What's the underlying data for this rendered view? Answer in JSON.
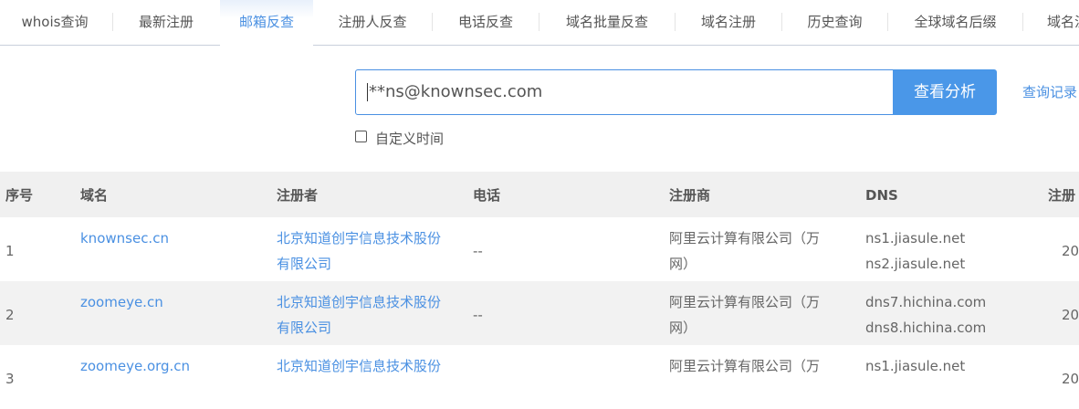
{
  "tabs": [
    "whois查询",
    "最新注册",
    "邮箱反查",
    "注册人反查",
    "电话反查",
    "域名批量反查",
    "域名注册",
    "历史查询",
    "全球域名后缀",
    "域名注"
  ],
  "active_tab": 2,
  "search": {
    "value": "**ns@knownsec.com",
    "button": "查看分析",
    "history_link": "查询记录",
    "custom_time_label": "自定义时间"
  },
  "table": {
    "headers": [
      "序号",
      "域名",
      "注册者",
      "电话",
      "注册商",
      "DNS",
      "注册"
    ],
    "rows": [
      {
        "index": "1",
        "domain": "knownsec.cn",
        "registrant_line1": "北京知道创宇信息技术股份",
        "registrant_line2": "有限公司",
        "phone": "--",
        "registrar_line1": "阿里云计算有限公司（万",
        "registrar_line2": "网）",
        "dns1": "ns1.jiasule.net",
        "dns2": "ns2.jiasule.net",
        "date": "20"
      },
      {
        "index": "2",
        "domain": "zoomeye.cn",
        "registrant_line1": "北京知道创宇信息技术股份",
        "registrant_line2": "有限公司",
        "phone": "--",
        "registrar_line1": "阿里云计算有限公司（万",
        "registrar_line2": "网）",
        "dns1": "dns7.hichina.com",
        "dns2": "dns8.hichina.com",
        "date": "20"
      },
      {
        "index": "3",
        "domain": "zoomeye.org.cn",
        "registrant_line1": "北京知道创宇信息技术股份",
        "registrant_line2": "",
        "phone": "",
        "registrar_line1": "阿里云计算有限公司（万",
        "registrar_line2": "",
        "dns1": "ns1.jiasule.net",
        "dns2": "",
        "date": "20"
      }
    ]
  }
}
